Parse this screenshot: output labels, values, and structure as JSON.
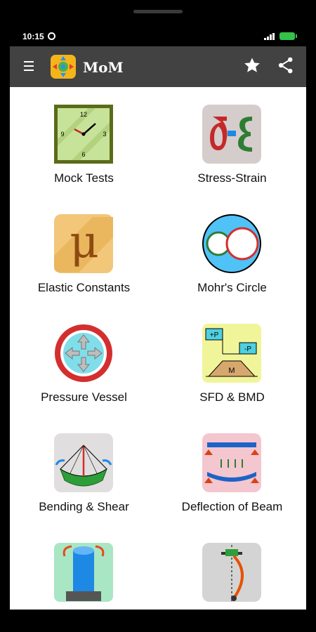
{
  "status": {
    "time": "10:15"
  },
  "app": {
    "title": "MoM"
  },
  "tiles": [
    {
      "label": "Mock Tests",
      "icon": "clock-icon"
    },
    {
      "label": "Stress-Strain",
      "icon": "sigma-epsilon-icon"
    },
    {
      "label": "Elastic Constants",
      "icon": "mu-icon"
    },
    {
      "label": "Mohr's Circle",
      "icon": "mohrs-circle-icon"
    },
    {
      "label": "Pressure Vessel",
      "icon": "pressure-vessel-icon"
    },
    {
      "label": "SFD & BMD",
      "icon": "sfd-bmd-icon"
    },
    {
      "label": "Bending & Shear",
      "icon": "bending-icon"
    },
    {
      "label": "Deflection of Beam",
      "icon": "beam-deflection-icon"
    },
    {
      "label": "",
      "icon": "torsion-shaft-icon"
    },
    {
      "label": "",
      "icon": "column-icon"
    }
  ],
  "icon_text": {
    "clock_12": "12",
    "clock_3": "3",
    "clock_6": "6",
    "clock_9": "9",
    "mu": "μ",
    "sfd_plus": "+P",
    "sfd_minus": "-P",
    "sfd_m": "M"
  },
  "colors": {
    "appbar": "#424242",
    "logo": "#f3b51a",
    "battery": "#35c04a"
  }
}
